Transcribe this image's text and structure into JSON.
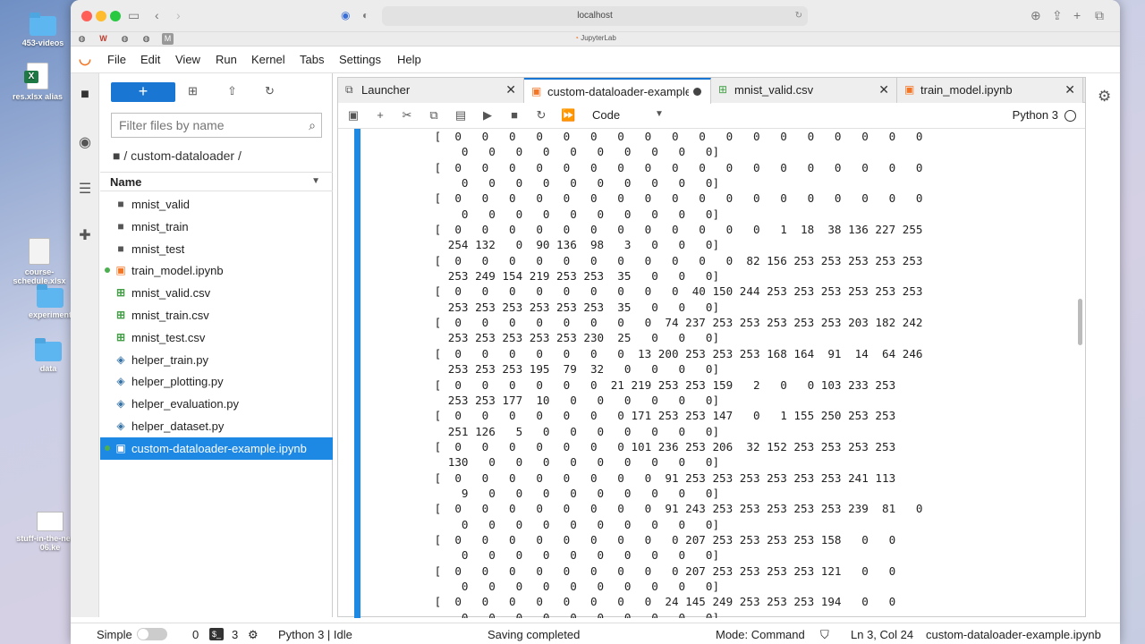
{
  "desktop": {
    "icons": [
      {
        "label": "453-videos",
        "kind": "folder"
      },
      {
        "label": "res.xlsx alias",
        "kind": "xlsx"
      },
      {
        "label": "course-schedule.xlsx",
        "kind": "doc"
      },
      {
        "label": "experiment",
        "kind": "folder"
      },
      {
        "label": "data",
        "kind": "folder"
      },
      {
        "label": "stuff-in-the-news-06.ke",
        "kind": "slide"
      }
    ]
  },
  "browser": {
    "url": "localhost",
    "tab_caption": "JupyterLab"
  },
  "menu": [
    "File",
    "Edit",
    "View",
    "Run",
    "Kernel",
    "Tabs",
    "Settings",
    "Help"
  ],
  "filebrowser": {
    "new_label": "+",
    "filter_placeholder": "Filter files by name",
    "breadcrumb": "/ custom-dataloader /",
    "column_name": "Name",
    "files": [
      {
        "name": "mnist_valid",
        "type": "folder"
      },
      {
        "name": "mnist_train",
        "type": "folder"
      },
      {
        "name": "mnist_test",
        "type": "folder"
      },
      {
        "name": "train_model.ipynb",
        "type": "notebook",
        "running": true
      },
      {
        "name": "mnist_valid.csv",
        "type": "csv"
      },
      {
        "name": "mnist_train.csv",
        "type": "csv"
      },
      {
        "name": "mnist_test.csv",
        "type": "csv"
      },
      {
        "name": "helper_train.py",
        "type": "py"
      },
      {
        "name": "helper_plotting.py",
        "type": "py"
      },
      {
        "name": "helper_evaluation.py",
        "type": "py"
      },
      {
        "name": "helper_dataset.py",
        "type": "py"
      },
      {
        "name": "custom-dataloader-example.ipynb",
        "type": "notebook",
        "running": true,
        "selected": true
      }
    ]
  },
  "tabs": [
    {
      "label": "Launcher",
      "icon": "launcher-icon"
    },
    {
      "label": "custom-dataloader-example.ipynb",
      "icon": "notebook-icon",
      "active": true,
      "dirty": true
    },
    {
      "label": "mnist_valid.csv",
      "icon": "csv-icon"
    },
    {
      "label": "train_model.ipynb",
      "icon": "notebook-icon"
    }
  ],
  "toolbar": {
    "cell_type": "Code",
    "kernel": "Python 3"
  },
  "output_rows": [
    [
      "[  0   0   0   0   0   0   0   0   0   0   0   0   0   0   0   0   0   0",
      "   0   0   0   0   0   0   0   0   0   0]"
    ],
    [
      "[  0   0   0   0   0   0   0   0   0   0   0   0   0   0   0   0   0   0",
      "   0   0   0   0   0   0   0   0   0   0]"
    ],
    [
      "[  0   0   0   0   0   0   0   0   0   0   0   0   0   0   0   0   0   0",
      "   0   0   0   0   0   0   0   0   0   0]"
    ],
    [
      "[  0   0   0   0   0   0   0   0   0   0   0   0   1  18  38 136 227 255",
      " 254 132   0  90 136  98   3   0   0   0]"
    ],
    [
      "[  0   0   0   0   0   0   0   0   0   0   0  82 156 253 253 253 253 253",
      " 253 249 154 219 253 253  35   0   0   0]"
    ],
    [
      "[  0   0   0   0   0   0   0   0   0  40 150 244 253 253 253 253 253 253",
      " 253 253 253 253 253 253  35   0   0   0]"
    ],
    [
      "[  0   0   0   0   0   0   0   0  74 237 253 253 253 253 253 203 182 242",
      " 253 253 253 253 253 230  25   0   0   0]"
    ],
    [
      "[  0   0   0   0   0   0   0  13 200 253 253 253 168 164  91  14  64 246",
      " 253 253 253 195  79  32   0   0   0   0]"
    ],
    [
      "[  0   0   0   0   0   0  21 219 253 253 159   2   0   0 103 233 253",
      " 253 253 177  10   0   0   0   0   0   0]"
    ],
    [
      "[  0   0   0   0   0   0   0 171 253 253 147   0   1 155 250 253 253",
      " 251 126   5   0   0   0   0   0   0   0]"
    ],
    [
      "[  0   0   0   0   0   0   0 101 236 253 206  32 152 253 253 253 253",
      " 130   0   0   0   0   0   0   0   0   0]"
    ],
    [
      "[  0   0   0   0   0   0   0   0  91 253 253 253 253 253 253 241 113",
      "   9   0   0   0   0   0   0   0   0   0]"
    ],
    [
      "[  0   0   0   0   0   0   0   0  91 243 253 253 253 253 253 239  81   0",
      "   0   0   0   0   0   0   0   0   0   0]"
    ],
    [
      "[  0   0   0   0   0   0   0   0   0 207 253 253 253 253 158   0   0",
      "   0   0   0   0   0   0   0   0   0   0]"
    ],
    [
      "[  0   0   0   0   0   0   0   0   0 207 253 253 253 253 121   0   0",
      "   0   0   0   0   0   0   0   0   0   0]"
    ],
    [
      "[  0   0   0   0   0   0   0   0  24 145 249 253 253 253 194   0   0",
      "   0   0   0   0   0   0   0   0   0   0]"
    ]
  ],
  "statusbar": {
    "mode_label": "Simple",
    "terminals_count": "0",
    "kernels_count": "3",
    "kernel_status": "Python 3 | Idle",
    "save_status": "Saving completed",
    "mode": "Mode: Command",
    "cursor": "Ln 3, Col 24",
    "filename": "custom-dataloader-example.ipynb"
  },
  "colors": {
    "accent": "#1976d2",
    "selected_row": "#1e88e5",
    "jupyter_orange": "#f37626",
    "csv_green": "#43a047"
  }
}
